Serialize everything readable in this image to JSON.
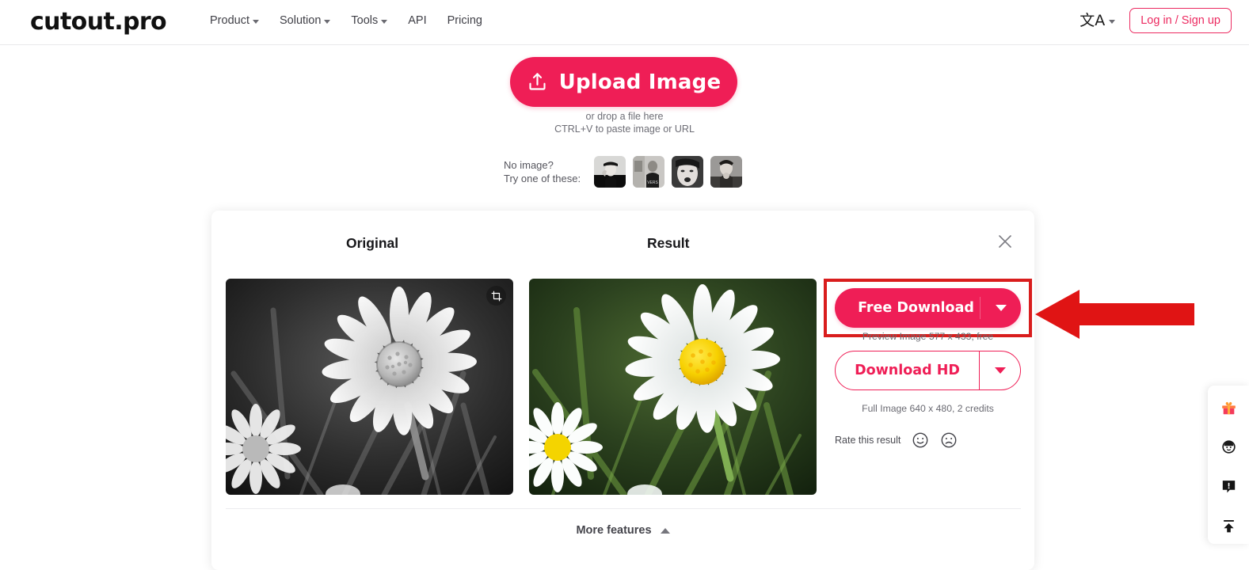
{
  "brand": {
    "logo_text": "cutout.pro",
    "accent": "#ef1e56",
    "annotation_red": "#d91d1d"
  },
  "header": {
    "nav": [
      {
        "label": "Product",
        "has_caret": true
      },
      {
        "label": "Solution",
        "has_caret": true
      },
      {
        "label": "Tools",
        "has_caret": true
      },
      {
        "label": "API",
        "has_caret": false
      },
      {
        "label": "Pricing",
        "has_caret": false
      }
    ],
    "language_glyph": "文A",
    "login_label": "Log in / Sign up"
  },
  "upload": {
    "button_label": "Upload Image",
    "drop_line1": "or drop a file here",
    "drop_line2": "CTRL+V to paste image or URL",
    "no_image_line1": "No image?",
    "no_image_line2": "Try one of these:",
    "thumbnails": [
      {
        "name": "sample-portrait-1"
      },
      {
        "name": "sample-portrait-2"
      },
      {
        "name": "sample-portrait-3"
      },
      {
        "name": "sample-portrait-4"
      }
    ]
  },
  "result_card": {
    "original_title": "Original",
    "result_title": "Result",
    "close_icon": "close-icon",
    "crop_icon": "crop-icon",
    "original_image_alt": "Black and white photo of a daisy flower in grass",
    "result_image_alt": "Colorized photo of a white daisy with yellow center in green grass",
    "free_download_label": "Free Download",
    "free_download_caption": "Preview Image 577 x 433, free",
    "hd_download_label": "Download HD",
    "hd_download_caption": "Full Image 640 x 480, 2 credits",
    "rate_label": "Rate this result",
    "rate_positive_icon": "smiley-happy-icon",
    "rate_negative_icon": "smiley-sad-icon",
    "more_features_label": "More features"
  },
  "float_toolbar": {
    "items": [
      {
        "name": "gift-icon",
        "glyph": "🎁"
      },
      {
        "name": "customer-service-icon"
      },
      {
        "name": "feedback-icon"
      },
      {
        "name": "back-to-top-icon"
      }
    ]
  }
}
